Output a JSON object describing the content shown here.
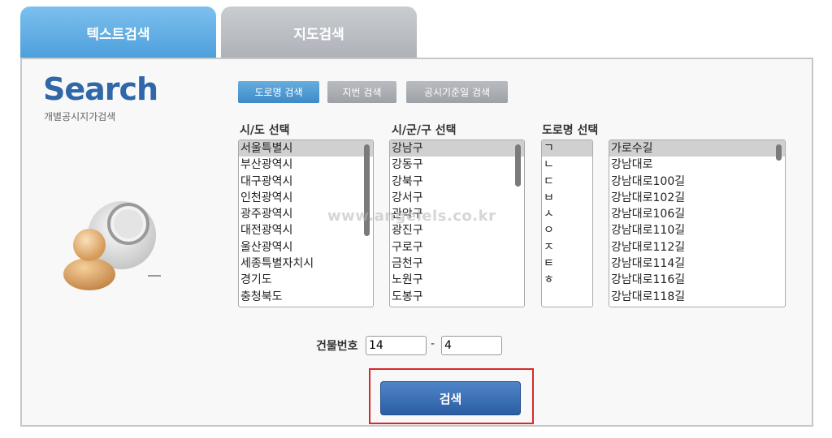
{
  "tabs": [
    {
      "label": "텍스트검색",
      "active": true
    },
    {
      "label": "지도검색",
      "active": false
    }
  ],
  "logo": {
    "word": "Search",
    "subtitle": "개별공시지가검색"
  },
  "modes": {
    "road": "도로명 검색",
    "lot": "지번 검색",
    "date": "공시기준일 검색"
  },
  "columns": {
    "sido": {
      "label": "시/도 선택",
      "selected": "서울특별시",
      "items": [
        "서울특별시",
        "부산광역시",
        "대구광역시",
        "인천광역시",
        "광주광역시",
        "대전광역시",
        "울산광역시",
        "세종특별자치시",
        "경기도",
        "충청북도"
      ]
    },
    "sigungu": {
      "label": "시/군/구 선택",
      "selected": "강남구",
      "items": [
        "강남구",
        "강동구",
        "강북구",
        "강서구",
        "관악구",
        "광진구",
        "구로구",
        "금천구",
        "노원구",
        "도봉구"
      ]
    },
    "road": {
      "label": "도로명 선택",
      "initials": [
        "ㄱ",
        "ㄴ",
        "ㄷ",
        "ㅂ",
        "ㅅ",
        "ㅇ",
        "ㅈ",
        "ㅌ",
        "ㅎ"
      ],
      "selected_initial": "ㄱ",
      "names": [
        "가로수길",
        "강남대로",
        "강남대로100길",
        "강남대로102길",
        "강남대로106길",
        "강남대로110길",
        "강남대로112길",
        "강남대로114길",
        "강남대로116길",
        "강남대로118길"
      ],
      "selected_name": "가로수길"
    }
  },
  "watermark": "www.angelels.co.kr",
  "building": {
    "label": "건물번호",
    "main": "14",
    "sub": "4",
    "separator": "-"
  },
  "search_button": "검색",
  "colors": {
    "active_tab": "#5aa8e2",
    "inactive_tab": "#b9bcc1",
    "button": "#3a6fb5",
    "highlight": "#d62a2a"
  }
}
